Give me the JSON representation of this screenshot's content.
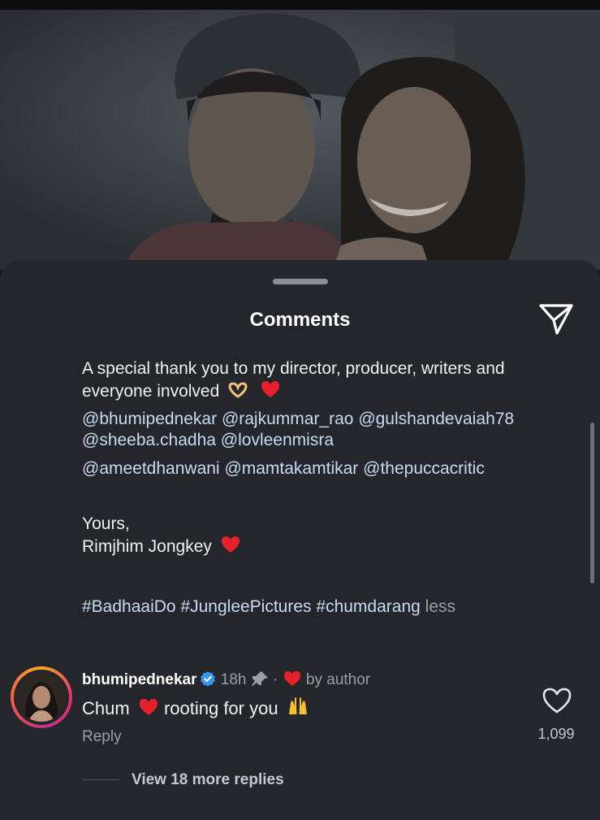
{
  "header": {
    "title": "Comments"
  },
  "caption": {
    "line1": "A special thank you to my director, producer, writers and",
    "line2": "everyone involved",
    "mentions_row1": [
      "@bhumipednekar",
      "@rajkummar_rao",
      "@gulshandevaiah78"
    ],
    "mentions_row2": [
      "@sheeba.chadha",
      "@lovleenmisra"
    ],
    "mentions_row3": [
      "@ameetdhanwani",
      "@mamtakamtikar",
      "@thepuccacritic"
    ],
    "signoff1": "Yours,",
    "signoff2": "Rimjhim Jongkey",
    "hashtags": [
      "#BadhaaiDo",
      "#JungleePictures",
      "#chumdarang"
    ],
    "less_label": "less"
  },
  "comment": {
    "username": "bhumipednekar",
    "time": "18h",
    "separator": "·",
    "liked_by": "by author",
    "text_part1": "Chum",
    "text_part2": "rooting for you",
    "reply_label": "Reply",
    "like_count": "1,099"
  },
  "view_replies": "View 18 more replies",
  "icons": {
    "share": "send-icon",
    "verified": "verified-badge-icon",
    "pin": "pin-icon",
    "heart": "red-heart-emoji",
    "like": "heart-outline-icon",
    "hands": "raised-hands-emoji",
    "heart_hands": "heart-hands-emoji"
  },
  "colors": {
    "sheet_bg": "#25262b",
    "mention": "#c6dbf5",
    "verified": "#3897f0",
    "heart": "#e8202e"
  }
}
